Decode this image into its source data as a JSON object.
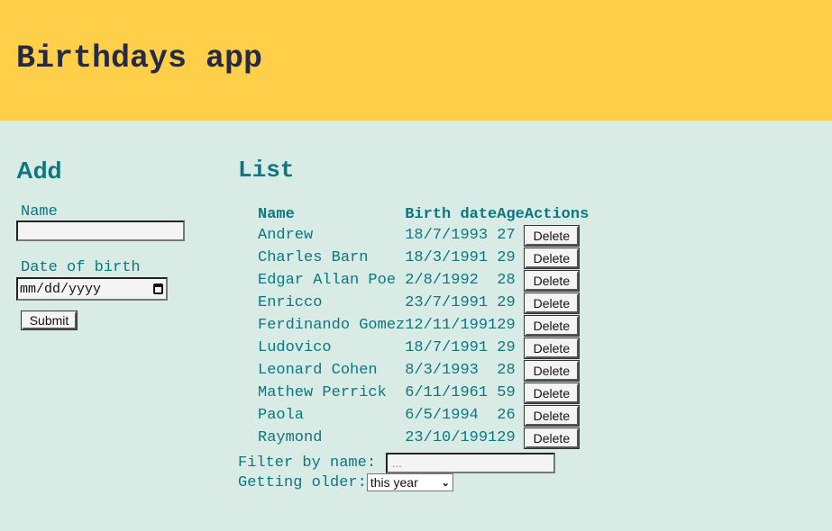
{
  "header": {
    "title": "Birthdays app"
  },
  "add": {
    "heading": "Add",
    "name_label": "Name",
    "name_value": "",
    "dob_label": "Date of birth",
    "dob_placeholder": "mm/dd/yyyy",
    "submit_label": "Submit"
  },
  "list": {
    "heading": "List",
    "columns": [
      "Name",
      "Birth date",
      "Age",
      "Actions"
    ],
    "delete_label": "Delete",
    "rows": [
      {
        "name": "Andrew",
        "birth_date": "18/7/1993",
        "age": "27"
      },
      {
        "name": "Charles Barn",
        "birth_date": "18/3/1991",
        "age": "29"
      },
      {
        "name": "Edgar Allan Poe",
        "birth_date": "2/8/1992",
        "age": "28"
      },
      {
        "name": "Enricco",
        "birth_date": "23/7/1991",
        "age": "29"
      },
      {
        "name": "Ferdinando Gomez",
        "birth_date": "12/11/1991",
        "age": "29"
      },
      {
        "name": "Ludovico",
        "birth_date": "18/7/1991",
        "age": "29"
      },
      {
        "name": "Leonard Cohen",
        "birth_date": "8/3/1993",
        "age": "28"
      },
      {
        "name": "Mathew Perrick",
        "birth_date": "6/11/1961",
        "age": "59"
      },
      {
        "name": "Paola",
        "birth_date": "6/5/1994",
        "age": "26"
      },
      {
        "name": "Raymond",
        "birth_date": "23/10/1991",
        "age": "29"
      }
    ],
    "filter_label": "Filter by name:",
    "filter_placeholder": "...",
    "older_label": "Getting older:",
    "older_selected": "this year"
  },
  "colors": {
    "header_bg": "#ffcf4a",
    "page_bg": "#d8ebe4",
    "accent": "#0d7680",
    "title": "#262a44"
  }
}
